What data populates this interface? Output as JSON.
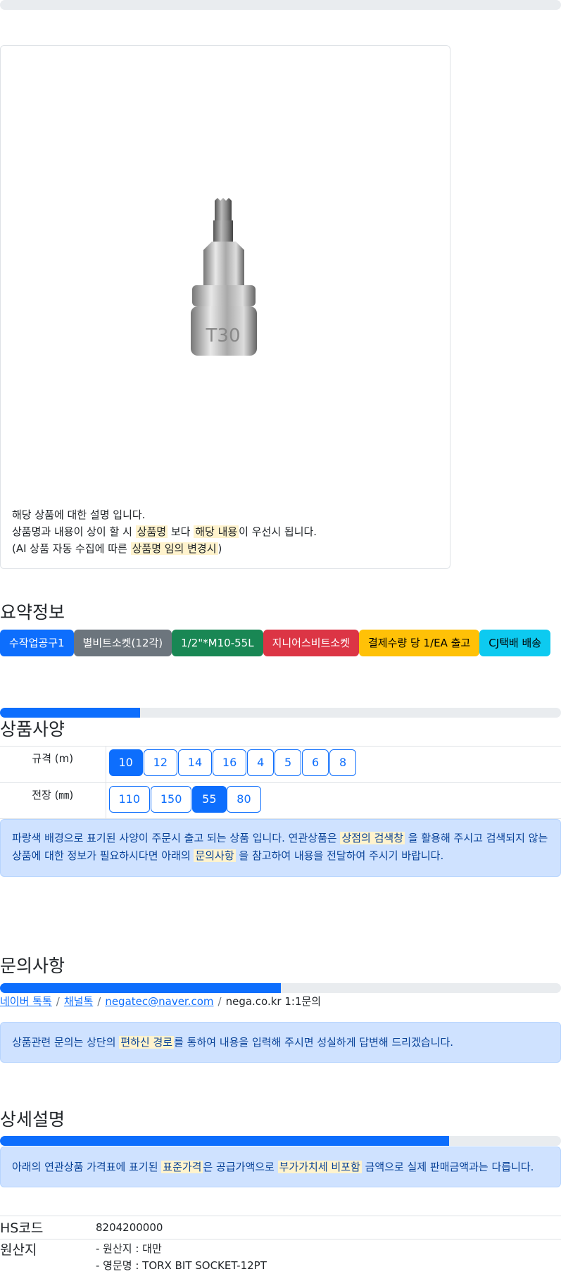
{
  "product": {
    "image_icon": "torx-bit-socket-image",
    "description_lines": {
      "line1": "해당 상품에 대한 설명 입니다.",
      "line2_prefix": "상품명과 내용이 상이 할 시 ",
      "line2_hl1": "상품명",
      "line2_mid": " 보다 ",
      "line2_hl2": "해당 내용",
      "line2_suffix": "이 우선시 됩니다.",
      "line3_prefix": "(AI 상품 자동 수집에 따른 ",
      "line3_hl": "상품명 임의 변경시",
      "line3_suffix": ")"
    }
  },
  "summary": {
    "title": "요약정보",
    "badges": [
      {
        "label": "수작업공구1",
        "color": "#0d6efd"
      },
      {
        "label": "별비트소켓(12각)",
        "color": "#6c757d"
      },
      {
        "label": "1/2\"*M10-55L",
        "color": "#198754"
      },
      {
        "label": "지니어스비트소켓",
        "color": "#dc3545"
      },
      {
        "label": "결제수량 당 1/EA 출고",
        "color": "#ffc107"
      },
      {
        "label": "CJ택배 배송",
        "color": "#0dcaf0"
      }
    ]
  },
  "spec": {
    "title": "상품사양",
    "progress_percent": 25,
    "rows": [
      {
        "label": "규격 (m)",
        "options": [
          "10",
          "12",
          "14",
          "16",
          "4",
          "5",
          "6",
          "8"
        ],
        "selected": "10"
      },
      {
        "label": "전장 (㎜)",
        "options": [
          "110",
          "150",
          "55",
          "80"
        ],
        "selected": "55"
      }
    ],
    "notice": {
      "p1": "파랑색 배경으로 표기된 사양이 주문시 출고 되는 상품 입니다. 연관상품은 ",
      "hl1": "상점의 검색창",
      "p2": " 을 활용해 주시고 검색되지 않는",
      "p3": "상품에 대한 정보가 필요하시다면 아래의 ",
      "hl2": "문의사항",
      "p4": " 을 참고하여 내용을 전달하여 주시기 바랍니다."
    }
  },
  "inquiry": {
    "title": "문의사항",
    "progress_percent": 50,
    "links": [
      "네이버 톡톡",
      "채널톡",
      "negatec@naver.com"
    ],
    "plain": "nega.co.kr 1:1문의",
    "sep": "/",
    "notice": {
      "p1": "상품관련 문의는 상단의 ",
      "hl": "편하신 경로",
      "p2": "를 통하여 내용을 입력해 주시면 성실하게 답변해 드리겠습니다."
    }
  },
  "detail": {
    "title": "상세설명",
    "progress_percent": 80,
    "notice": {
      "p1": "아래의 연관상품 가격표에 표기된 ",
      "hl1": "표준가격",
      "p2": "은 공급가액으로 ",
      "hl2": "부가가치세 비포함",
      "p3": " 금액으로 실제 판매금액과는 다릅니다."
    },
    "rows": [
      {
        "key": "HS코드",
        "lines": [
          "8204200000"
        ]
      },
      {
        "key": "원산지",
        "lines": [
          "- 원산지 : 대만",
          "- 영문명 : TORX BIT SOCKET-12PT"
        ]
      }
    ]
  }
}
